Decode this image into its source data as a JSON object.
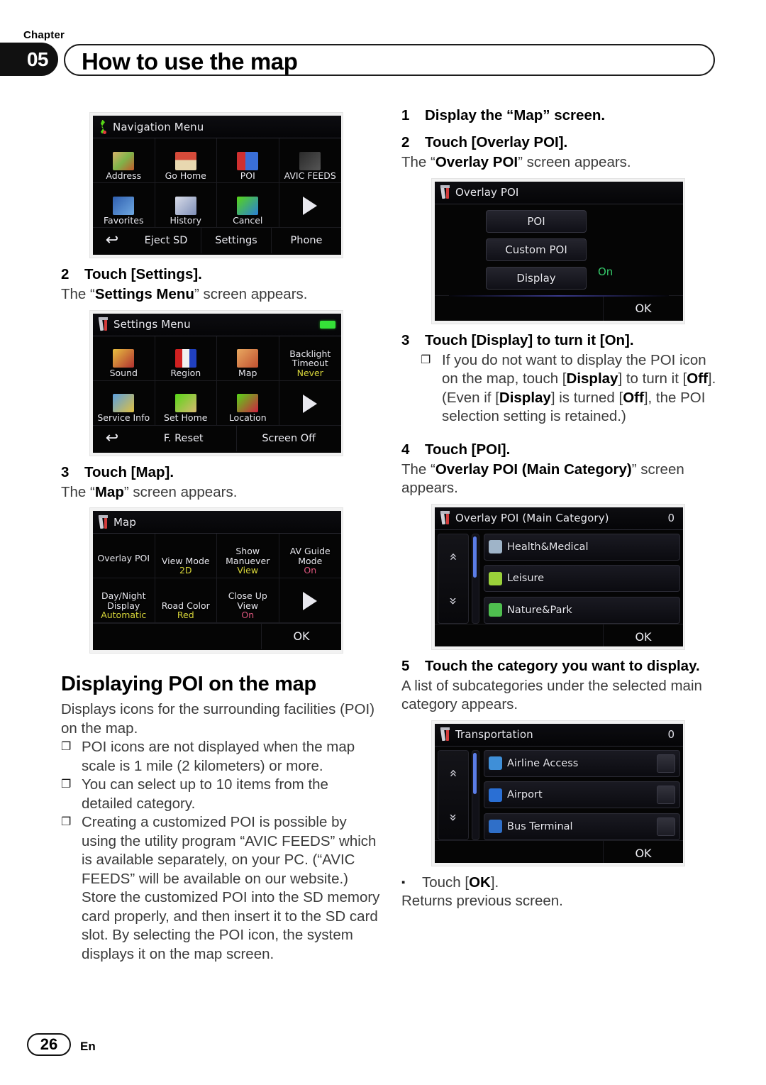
{
  "header": {
    "chapter_word": "Chapter",
    "chapter_number": "05",
    "title": "How to use the map"
  },
  "footer": {
    "page_number": "26",
    "language": "En"
  },
  "left_column": {
    "nav_menu_screen": {
      "title": "Navigation Menu",
      "cells": [
        {
          "label": "Address"
        },
        {
          "label": "Go Home"
        },
        {
          "label": "POI"
        },
        {
          "label": "AVIC FEEDS"
        },
        {
          "label": "Favorites"
        },
        {
          "label": "History"
        },
        {
          "label": "Cancel"
        },
        {
          "label": ""
        }
      ],
      "bottom": [
        "Eject SD",
        "Settings",
        "Phone"
      ],
      "back_glyph": "↩"
    },
    "step2": {
      "num": "2",
      "text": "Touch [Settings]."
    },
    "step2_desc_pre": "The “",
    "step2_desc_bold": "Settings Menu",
    "step2_desc_post": "” screen appears.",
    "settings_menu_screen": {
      "title": "Settings Menu",
      "cells": [
        {
          "label": "Sound",
          "value": ""
        },
        {
          "label": "Region",
          "value": ""
        },
        {
          "label": "Map",
          "value": ""
        },
        {
          "label": "Backlight Timeout",
          "value": "Never"
        },
        {
          "label": "Service Info",
          "value": ""
        },
        {
          "label": "Set Home",
          "value": ""
        },
        {
          "label": "Location",
          "value": ""
        },
        {
          "label": "",
          "value": ""
        }
      ],
      "bottom": [
        "F. Reset",
        "Screen Off"
      ],
      "back_glyph": "↩"
    },
    "step3": {
      "num": "3",
      "text": "Touch [Map]."
    },
    "step3_desc_pre": "The “",
    "step3_desc_bold": "Map",
    "step3_desc_post": "” screen appears.",
    "map_screen": {
      "title": "Map",
      "cells": [
        {
          "label": "Overlay POI",
          "value": ""
        },
        {
          "label": "View Mode",
          "value": "2D"
        },
        {
          "label": "Show Manuever",
          "value": "View"
        },
        {
          "label": "AV Guide Mode",
          "value": "On"
        },
        {
          "label": "Day/Night Display",
          "value": "Automatic"
        },
        {
          "label": "Road Color",
          "value": "Red"
        },
        {
          "label": "Close Up View",
          "value": "On"
        },
        {
          "label": "",
          "value": ""
        }
      ],
      "ok_label": "OK"
    },
    "heading": "Displaying POI on the map",
    "intro": "Displays icons for the surrounding facilities (POI) on the map.",
    "bullets": [
      "POI icons are not displayed when the map scale is 1 mile (2 kilometers) or more.",
      "You can select up to 10 items from the detailed category.",
      "Creating a customized POI is possible by using the utility program “AVIC FEEDS” which is available separately, on your PC. (“AVIC FEEDS” will be available on our website.) Store the customized POI into the SD memory card properly, and then insert it to the SD card slot. By selecting the POI icon, the system displays it on the map screen."
    ]
  },
  "right_column": {
    "step1": {
      "num": "1",
      "text": "Display the “Map” screen."
    },
    "step2": {
      "num": "2",
      "text": "Touch [Overlay POI]."
    },
    "step2_desc_pre": "The “",
    "step2_desc_bold": "Overlay POI",
    "step2_desc_post": "” screen appears.",
    "overlay_poi_screen": {
      "title": "Overlay POI",
      "buttons": [
        "POI",
        "Custom POI",
        "Display"
      ],
      "display_value": "On",
      "ok_label": "OK"
    },
    "step3": {
      "num": "3",
      "text": "Touch [Display] to turn it [On]."
    },
    "step3_bullet": {
      "p1": "If you do not want to display the POI icon on the map, touch [",
      "b1": "Display",
      "p2": "] to turn it [",
      "b2": "Off",
      "p3": "]. (Even if [",
      "b3": "Display",
      "p4": "] is turned [",
      "b4": "Off",
      "p5": "], the POI selection setting is retained.)"
    },
    "step4": {
      "num": "4",
      "text": "Touch [POI]."
    },
    "step4_desc_pre": "The “",
    "step4_desc_bold": "Overlay POI (Main Category)",
    "step4_desc_post": "” screen appears.",
    "main_category_screen": {
      "title": "Overlay POI (Main Category)",
      "count": "0",
      "rows": [
        {
          "label": "Health&Medical",
          "icon_color": "#9fb4c8"
        },
        {
          "label": "Leisure",
          "icon_color": "#f0a030"
        },
        {
          "label": "Nature&Park",
          "icon_color": "#4fbf4f"
        }
      ],
      "up_glyph": "»",
      "down_glyph": "»",
      "ok_label": "OK"
    },
    "step5": {
      "num": "5",
      "text": "Touch the category you want to display."
    },
    "step5_desc": "A list of subcategories under the selected main category appears.",
    "transportation_screen": {
      "title": "Transportation",
      "count": "0",
      "rows": [
        {
          "label": "Airline Access",
          "icon_color": "#3f8fd8"
        },
        {
          "label": "Airport",
          "icon_color": "#2a6fd4"
        },
        {
          "label": "Bus Terminal",
          "icon_color": "#2f6fc8"
        }
      ],
      "ok_label": "OK"
    },
    "final_bullet_pre": "Touch [",
    "final_bullet_bold": "OK",
    "final_bullet_post": "].",
    "final_desc": "Returns previous screen."
  }
}
